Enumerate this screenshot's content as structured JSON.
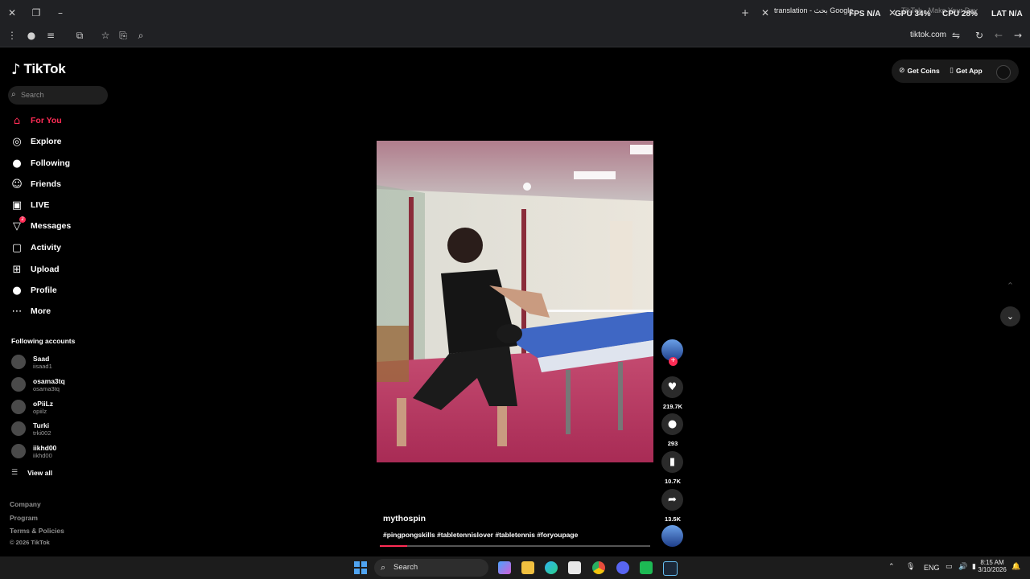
{
  "browser": {
    "tabs": [
      {
        "title": "translation - بحث Google"
      },
      {
        "title": "TikTok - Make Your Day"
      }
    ],
    "perf": {
      "fps_label": "FPS",
      "fps_value": "N/A",
      "gpu_label": "GPU",
      "gpu_value": "34%",
      "cpu_label": "CPU",
      "cpu_value": "28%",
      "lat_label": "LAT",
      "lat_value": "N/A"
    },
    "url": "tiktok.com",
    "icons": {
      "close": "close-icon",
      "restore": "restore-icon",
      "minimize": "minimize-icon",
      "new_tab": "plus-icon"
    }
  },
  "sidebar": {
    "logo": "TikTok",
    "search_placeholder": "Search",
    "nav": [
      {
        "label": "For You",
        "icon": "home-icon",
        "glyph": "⌂",
        "active": true
      },
      {
        "label": "Explore",
        "icon": "compass-icon",
        "glyph": "◎"
      },
      {
        "label": "Following",
        "icon": "following-avatar-icon",
        "glyph": "●"
      },
      {
        "label": "Friends",
        "icon": "friends-icon",
        "glyph": "☺"
      },
      {
        "label": "LIVE",
        "icon": "live-icon",
        "glyph": "▣"
      },
      {
        "label": "Messages",
        "icon": "messages-icon",
        "glyph": "▽",
        "badge": "2"
      },
      {
        "label": "Activity",
        "icon": "activity-icon",
        "glyph": "▢"
      },
      {
        "label": "Upload",
        "icon": "upload-icon",
        "glyph": "⊞"
      },
      {
        "label": "Profile",
        "icon": "profile-icon",
        "glyph": "●"
      },
      {
        "label": "More",
        "icon": "more-icon",
        "glyph": "⋯"
      }
    ],
    "following_accounts_title": "Following accounts",
    "accounts": [
      {
        "name": "Saad",
        "handle": "iisaad1"
      },
      {
        "name": "osama3tq",
        "handle": "osama3tq"
      },
      {
        "name": "oPiiLz",
        "handle": "opiilz"
      },
      {
        "name": "Turki",
        "handle": "trki002"
      },
      {
        "name": "iikhd00",
        "handle": "iikhd00"
      }
    ],
    "view_all": "View all",
    "footer": [
      "Company",
      "Program",
      "Terms & Policies",
      "© 2026 TikTok"
    ]
  },
  "topbar": {
    "get_coins": "Get Coins",
    "get_app": "Get App"
  },
  "video": {
    "author": "mythospin",
    "caption": "#pingpongskills #tabletennislover #tabletennis #foryoupage",
    "progress": 0.1
  },
  "actions": {
    "likes": "219.7K",
    "comments": "293",
    "saves": "10.7K",
    "shares": "13.5K"
  },
  "taskbar": {
    "search": "Search",
    "lang": "ENG",
    "time": "8:15 AM",
    "date": "3/10/2026"
  }
}
